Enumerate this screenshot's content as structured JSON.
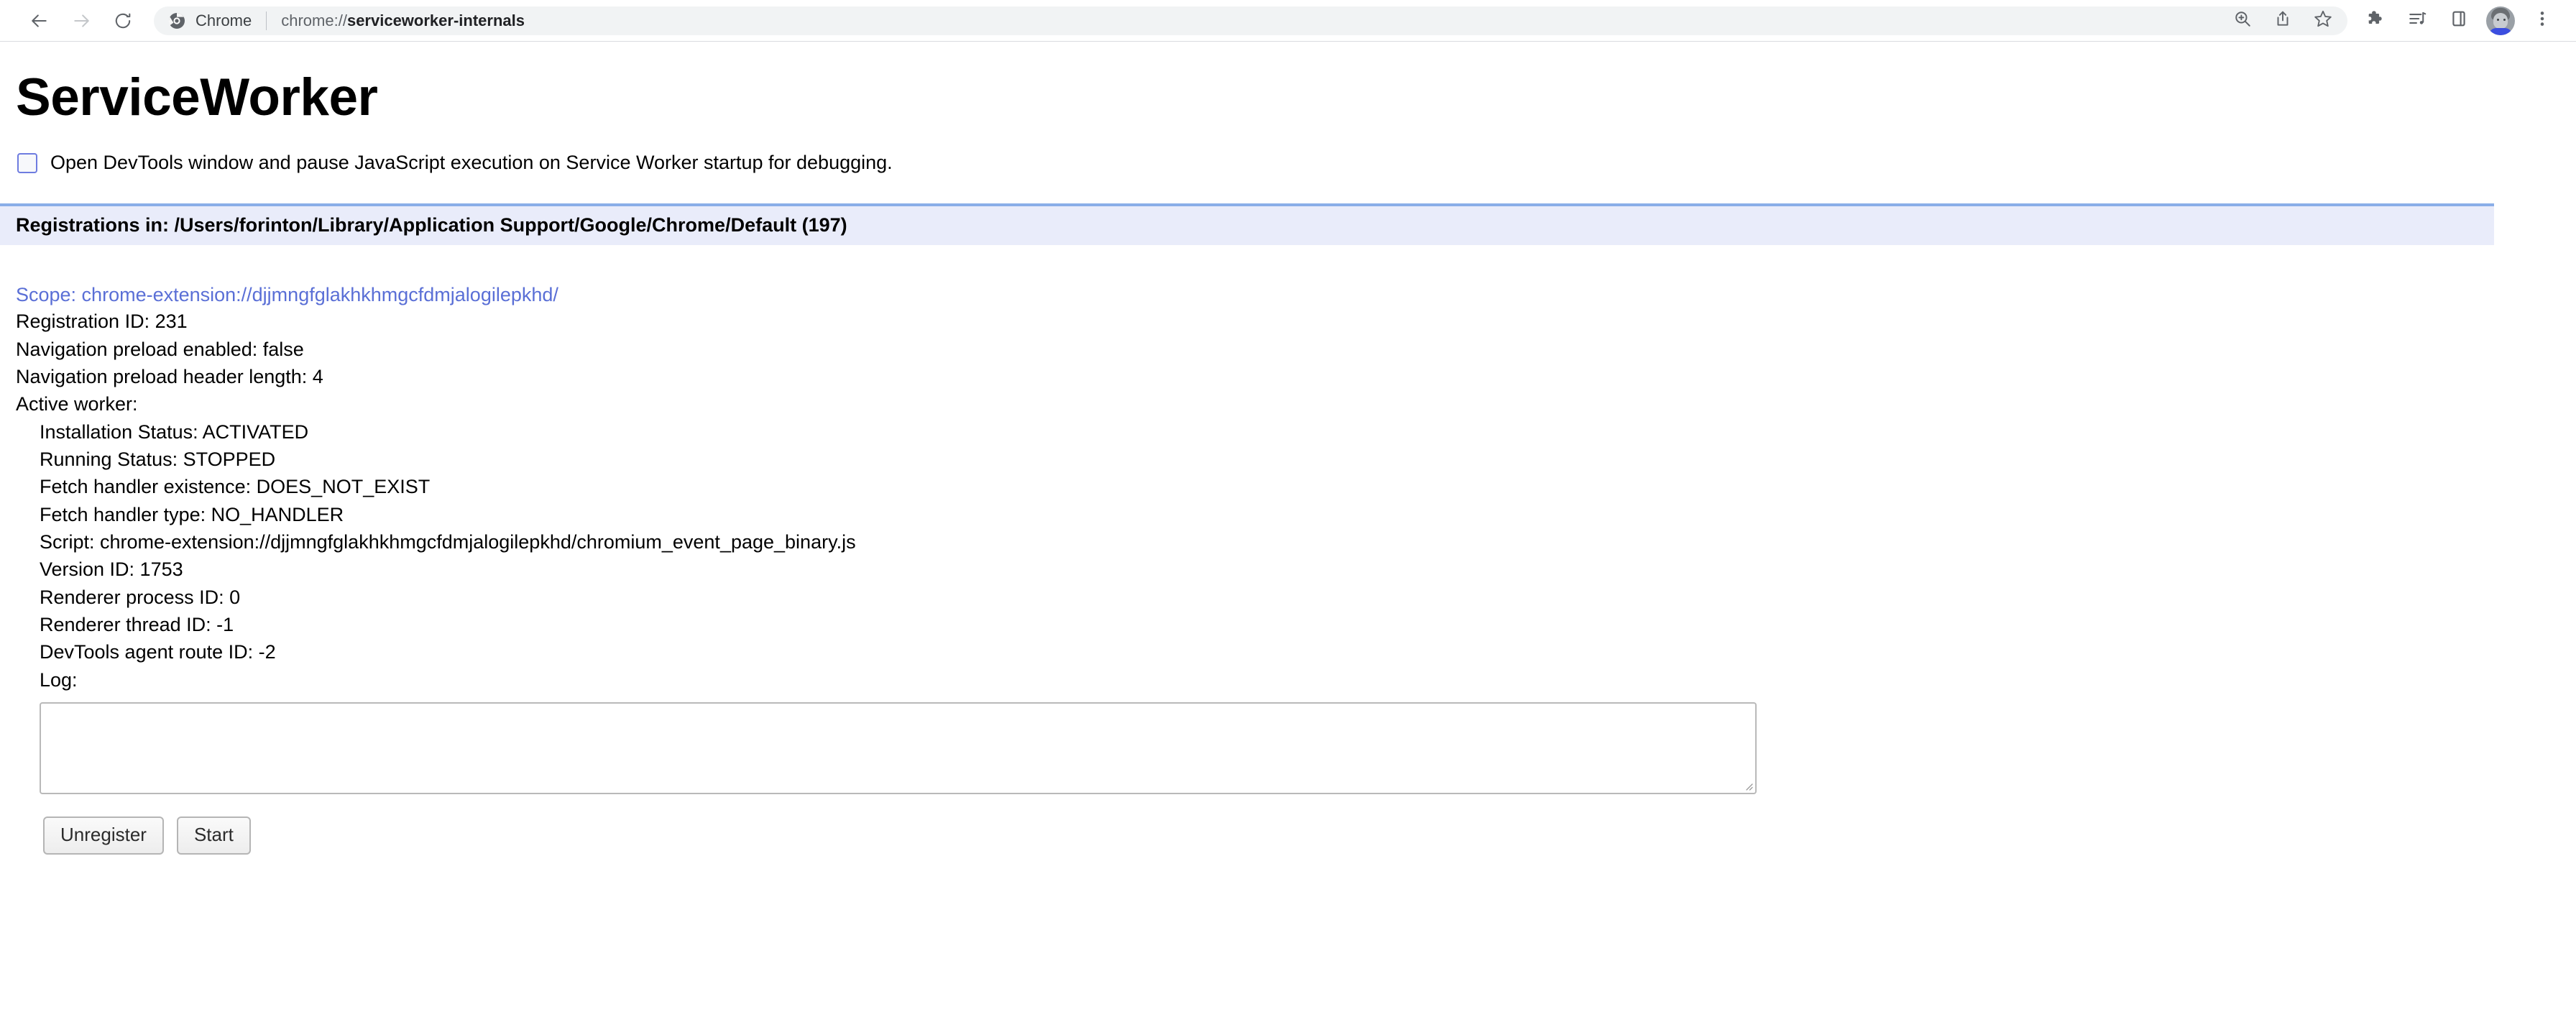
{
  "browser": {
    "nav": {
      "back_tooltip": "Back",
      "forward_tooltip": "Forward",
      "reload_tooltip": "Reload"
    },
    "omnibox": {
      "chip_label": "Chrome",
      "url_scheme": "chrome://",
      "url_rest": "serviceworker-internals",
      "url_full": "chrome://serviceworker-internals",
      "zoom_tooltip": "Zoom",
      "share_tooltip": "Share this page",
      "bookmark_tooltip": "Bookmark this tab"
    },
    "toolbar_right": {
      "extensions_tooltip": "Extensions",
      "reading_list_tooltip": "Reading list",
      "side_panel_tooltip": "Side panel",
      "profile_tooltip": "Profile",
      "menu_tooltip": "Customize and control Google Chrome"
    },
    "colors": {
      "omnibox_bg": "#f1f3f4",
      "toolbar_border": "#dadce0",
      "icon": "#5f6368",
      "icon_disabled": "#bdc1c6",
      "url_emphasis": "#202124"
    }
  },
  "page": {
    "title": "ServiceWorker",
    "devtools_option": {
      "checked": false,
      "label": "Open DevTools window and pause JavaScript execution on Service Worker startup for debugging."
    },
    "registrations_header": "Registrations in: /Users/forinton/Library/Application Support/Google/Chrome/Default (197)",
    "colors": {
      "header_bg": "#e9ecfa",
      "header_border_top": "#8aaee8",
      "link": "#5a6fd6",
      "checkbox_border": "#6e7ce0"
    },
    "registration": {
      "scope": "Scope: chrome-extension://djjmngfglakhkhmgcfdmjalogilepkhd/",
      "registration_id": "Registration ID: 231",
      "navigation_preload_enabled": "Navigation preload enabled: false",
      "navigation_preload_header_length": "Navigation preload header length: 4",
      "active_worker_label": "Active worker:",
      "worker": {
        "installation_status": "Installation Status: ACTIVATED",
        "running_status": "Running Status: STOPPED",
        "fetch_handler_existence": "Fetch handler existence: DOES_NOT_EXIST",
        "fetch_handler_type": "Fetch handler type: NO_HANDLER",
        "script": "Script: chrome-extension://djjmngfglakhkhmgcfdmjalogilepkhd/chromium_event_page_binary.js",
        "version_id": "Version ID: 1753",
        "renderer_process_id": "Renderer process ID: 0",
        "renderer_thread_id": "Renderer thread ID: -1",
        "devtools_agent_route_id": "DevTools agent route ID: -2",
        "log_label": "Log:",
        "log_value": ""
      },
      "buttons": {
        "unregister": "Unregister",
        "start": "Start"
      }
    }
  }
}
